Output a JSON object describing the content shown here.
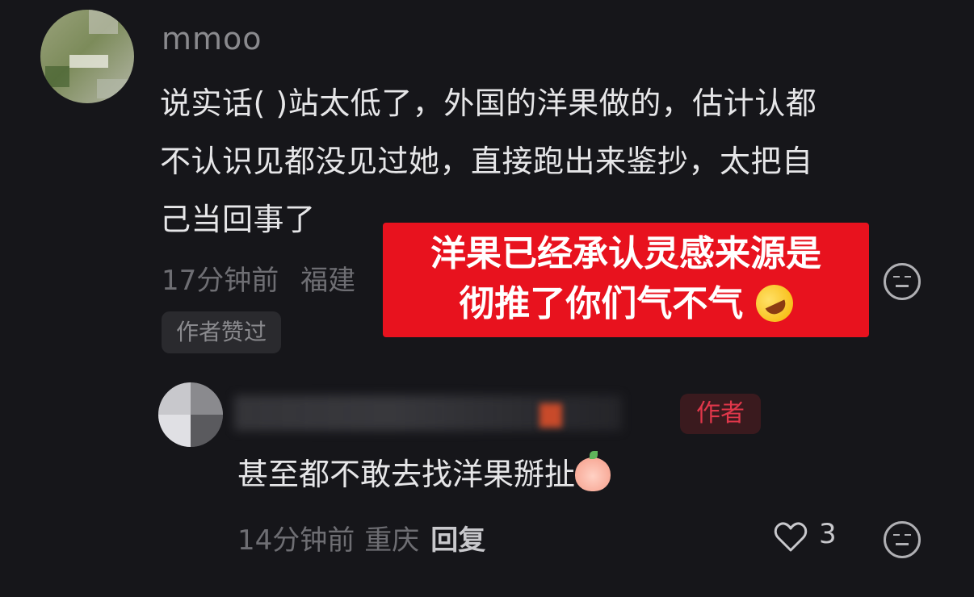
{
  "comment": {
    "username": "mmoo",
    "text_lines": [
      "说实话( )站太低了，外国的洋果做的，估计认都",
      "不认识见都没见过她，直接跑出来鉴抄，太把自",
      "己当回事了"
    ],
    "time": "17分钟前",
    "location": "福建",
    "author_liked": "作者赞过"
  },
  "overlay": {
    "line1": "洋果已经承认灵感来源是",
    "line2": "彻推了你们气不气",
    "background": "#e8121e"
  },
  "reply": {
    "badge": "作者",
    "text": "甚至都不敢去找洋果掰扯",
    "time": "14分钟前",
    "location": "重庆",
    "reply_label": "回复",
    "like_count": "3",
    "badge_color": "#e0374a"
  },
  "icons": {
    "emoji_button": "emoji-face-icon",
    "heart": "heart-icon",
    "overlay_emoji": "rofl-emoji",
    "reply_emoji": "peach-emoji"
  }
}
